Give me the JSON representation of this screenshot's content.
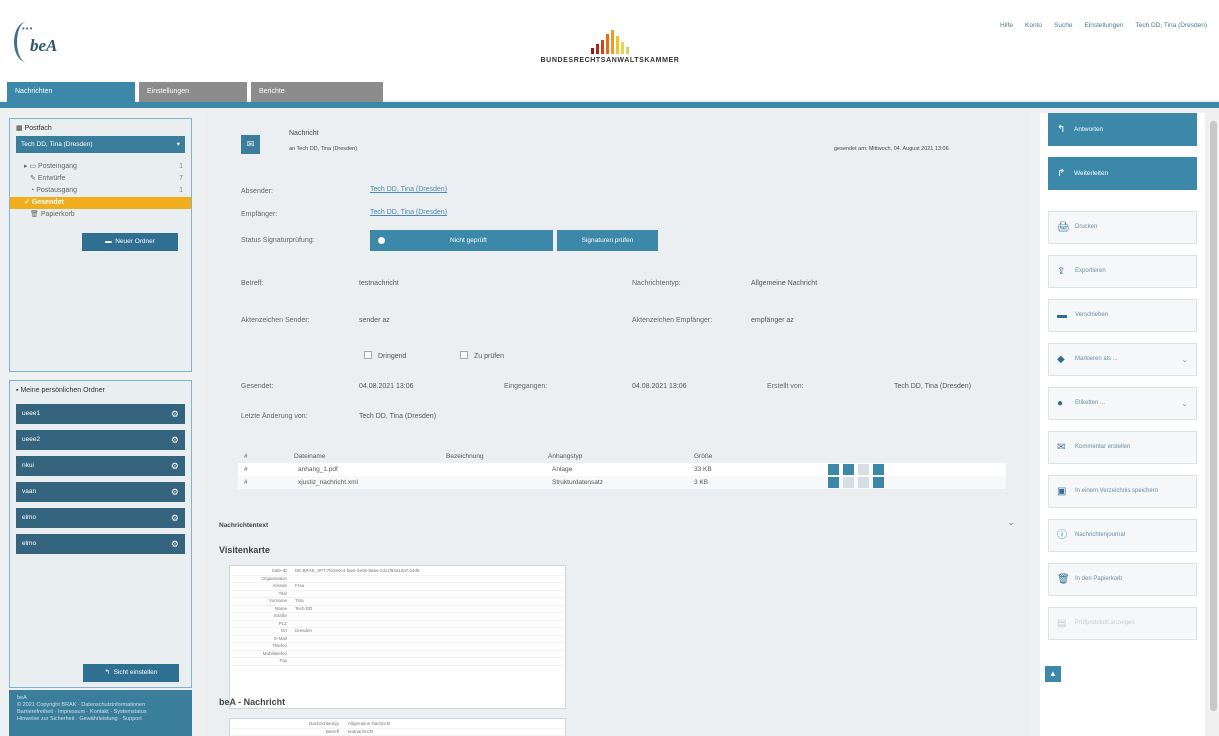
{
  "header": {
    "logo_text": "beA",
    "brand": "BUNDESRECHTSANWALTSKAMMER",
    "brand_colors": [
      "#8a1c1c",
      "#b02a1a",
      "#d2451c",
      "#e46a1e",
      "#f09a20",
      "#f2c228",
      "#e9d44a",
      "#d8d070"
    ],
    "top_links": [
      "Hilfe",
      "Konto",
      "Suche",
      "Einstellungen",
      "Tech DD, Tina (Dresden)"
    ]
  },
  "nav": {
    "tabs": [
      "Nachrichten",
      "Einstellungen",
      "Berichte"
    ]
  },
  "left": {
    "postbox_label": "Postfach",
    "postbox_value": "Tech DD, Tina (Dresden)",
    "folders": [
      {
        "label": "Posteingang",
        "count": "1"
      },
      {
        "label": "Entwürfe",
        "count": "7"
      },
      {
        "label": "Postausgang",
        "count": "1"
      },
      {
        "label": "Gesendet",
        "count": ""
      },
      {
        "label": "Papierkorb",
        "count": ""
      }
    ],
    "new_folder_button": "Neuer Ordner",
    "personal_folders_title": "Meine persönlichen Ordner",
    "personal_folders": [
      "ueee1",
      "ueee2",
      "nkui",
      "vaan",
      "elmo",
      "elmo"
    ],
    "sort_button": "Sicht einstellen",
    "footer": [
      "beA",
      "© 2021 Copyright BRAK · Datenschutzinformationen",
      "Barrierefreiheit · Impressum · Kontakt · Systemstatus",
      "Hinweise zur Sicherheit · Gewährleistung · Support"
    ]
  },
  "message": {
    "title": "Nachricht",
    "to_line": "an Tech DD, Tina (Dresden)",
    "sent_info": "gesendet am: Mittwoch, 04. August 2021 13:06",
    "absender_label": "Absender:",
    "absender": "Tech DD, Tina (Dresden)",
    "empfaenger_label": "Empfänger:",
    "empfaenger": "Tech DD, Tina (Dresden)",
    "status_label": "Status Signaturprüfung:",
    "status_value": "Nicht geprüft",
    "check_button": "Signaturen prüfen",
    "betreff_label": "Betreff:",
    "betreff": "testnachricht",
    "typ_label": "Nachrichtentyp:",
    "typ": "Allgemeine Nachricht",
    "az_sender_label": "Aktenzeichen Sender:",
    "az_sender": "sender az",
    "az_empf_label": "Aktenzeichen Empfänger:",
    "az_empf": "empfänger az",
    "dringend": "Dringend",
    "pruefen": "Zu prüfen",
    "gesendet_label": "Gesendet:",
    "gesendet": "04.08.2021 13:06",
    "eingegangen_label": "Eingegangen:",
    "eingegangen": "04.08.2021 13:06",
    "erstellt_label": "Erstellt von:",
    "erstellt": "Tech DD, Tina (Dresden)",
    "aenderung_label": "Letzte Änderung von:",
    "aenderung": "Tech DD, Tina (Dresden)"
  },
  "attachments": {
    "headers": [
      "#",
      "Dateiname",
      "Bezeichnung",
      "Anhangstyp",
      "Größe"
    ],
    "rows": [
      {
        "num": "#",
        "name": "anhang_1.pdf",
        "desc": "",
        "type": "Anlage",
        "size": "33 KB"
      },
      {
        "num": "#",
        "name": "xjustiz_nachricht.xml",
        "desc": "",
        "type": "Strukturdatensatz",
        "size": "3 KB"
      }
    ]
  },
  "body": {
    "nachrichtentext": "Nachrichtentext",
    "visitenkarte": "Visitenkarte",
    "visit_rows": [
      {
        "k": "Safe-ID",
        "v": "DE.BRAK_SPT.7fe2e0c4-fae6-4e0b-9a5e-cd11f94a10a7.b4d5"
      },
      {
        "k": "Organisation",
        "v": ""
      },
      {
        "k": "Anrede",
        "v": "Frau"
      },
      {
        "k": "Titel",
        "v": ""
      },
      {
        "k": "Vorname",
        "v": "Tina"
      },
      {
        "k": "Name",
        "v": "Tech DD"
      },
      {
        "k": "Straße",
        "v": ""
      },
      {
        "k": "PLZ",
        "v": ""
      },
      {
        "k": "Ort",
        "v": "Dresden"
      },
      {
        "k": "E-Mail",
        "v": ""
      },
      {
        "k": "Telefon",
        "v": ""
      },
      {
        "k": "Mobiltelefon",
        "v": ""
      },
      {
        "k": "Fax",
        "v": ""
      }
    ],
    "bea_nachricht": "beA - Nachricht",
    "bea_rows": [
      {
        "k": "Nachrichtentyp",
        "v": "Allgemeine Nachricht"
      },
      {
        "k": "Betreff",
        "v": "testnachricht"
      }
    ]
  },
  "actions": {
    "reply": "Antworten",
    "forward": "Weiterleiten",
    "buttons": [
      {
        "label": "Drucken",
        "icon": "printer-icon",
        "glyph": "🖨",
        "chevron": false,
        "disabled": false
      },
      {
        "label": "Exportieren",
        "icon": "export-icon",
        "glyph": "⇪",
        "chevron": false,
        "disabled": false
      },
      {
        "label": "Verschieben",
        "icon": "folder-icon",
        "glyph": "▬",
        "chevron": false,
        "disabled": false
      },
      {
        "label": "Markieren als ...",
        "icon": "bookmark-icon",
        "glyph": "◆",
        "chevron": true,
        "disabled": false
      },
      {
        "label": "Etiketten ...",
        "icon": "tags-icon",
        "glyph": "●",
        "chevron": true,
        "disabled": false
      },
      {
        "label": "Kommentar erstellen",
        "icon": "comment-icon",
        "glyph": "✉",
        "chevron": false,
        "disabled": false
      },
      {
        "label": "In einem Verzeichnis speichern",
        "icon": "save-icon",
        "glyph": "▣",
        "chevron": false,
        "disabled": false
      },
      {
        "label": "Nachrichtenjournal",
        "icon": "info-icon",
        "glyph": "ⓘ",
        "chevron": false,
        "disabled": false
      },
      {
        "label": "In den Papierkorb",
        "icon": "trash-icon",
        "glyph": "🗑",
        "chevron": false,
        "disabled": false
      },
      {
        "label": "Prüfprotokoll anzeigen",
        "icon": "protocol-icon",
        "glyph": "▤",
        "chevron": false,
        "disabled": true
      }
    ]
  }
}
